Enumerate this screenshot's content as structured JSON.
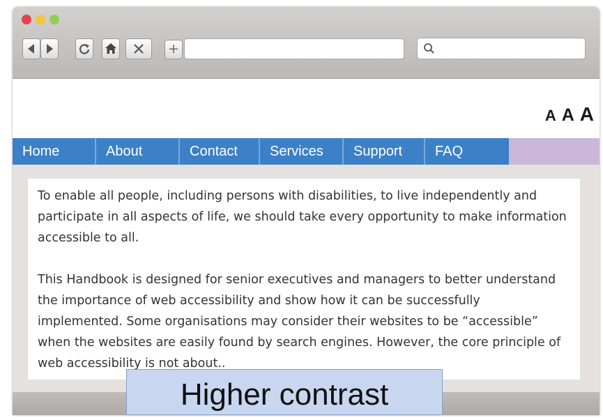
{
  "browser": {
    "search_icon": "search-icon",
    "new_tab_label": "+"
  },
  "text_size": {
    "small": "A",
    "medium": "A",
    "large": "A"
  },
  "menu": {
    "items": [
      {
        "label": "Home"
      },
      {
        "label": "About"
      },
      {
        "label": "Contact"
      },
      {
        "label": "Services"
      },
      {
        "label": "Support"
      },
      {
        "label": "FAQ"
      }
    ]
  },
  "content": {
    "paragraph1": "To enable all people, including persons with disabilities, to live independently and participate in all aspects of life, we should take every opportunity to make information accessible to all.",
    "paragraph2": "This Handbook is designed for senior executives and managers to better understand the importance of web accessibility and show how it can be successfully implemented. Some organisations may consider their websites to be “accessible” when the websites are easily found by search engines. However, the core principle of web accessibility is not about.."
  },
  "caption": "Higher contrast",
  "colors": {
    "menu_blue": "#3c80c8",
    "menu_filler": "#cbb8d8",
    "caption_bg": "#c9d6f0"
  }
}
